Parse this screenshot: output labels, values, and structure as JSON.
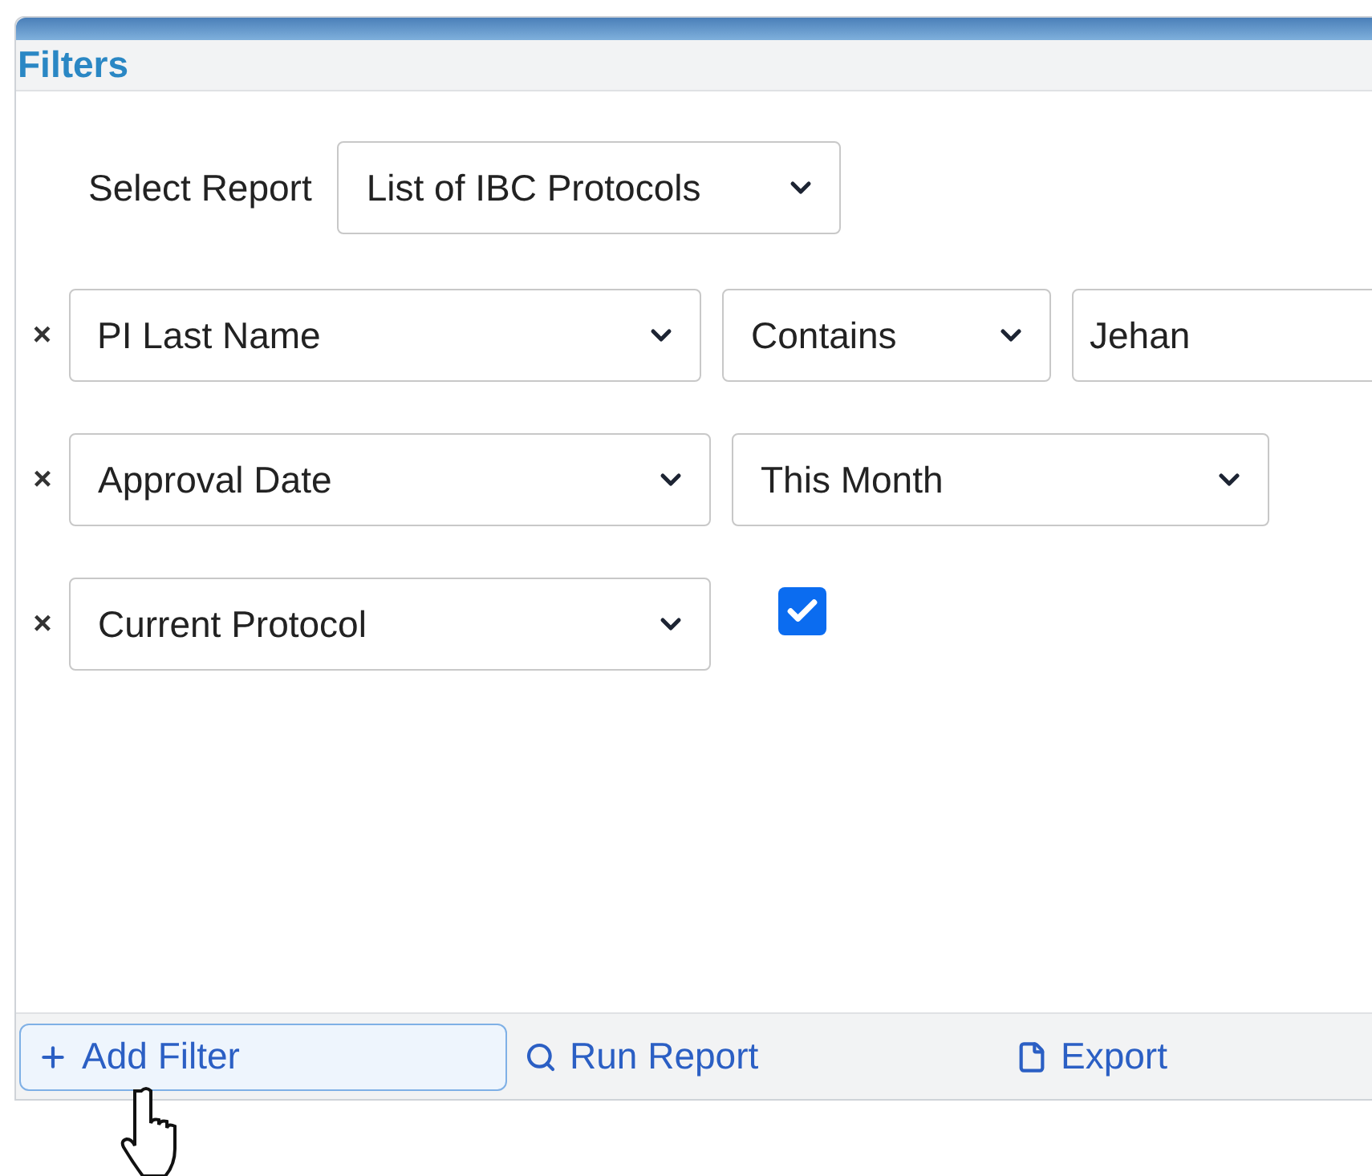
{
  "panel": {
    "title": "Filters"
  },
  "report": {
    "label": "Select Report",
    "value": "List of IBC Protocols"
  },
  "filters": [
    {
      "remove": "×",
      "field": "PI Last Name",
      "operator": {
        "kind": "select",
        "value": "Contains"
      },
      "value": {
        "kind": "input",
        "value": "Jehan"
      }
    },
    {
      "remove": "×",
      "field": "Approval Date",
      "operator": {
        "kind": "select",
        "value": "This Month"
      }
    },
    {
      "remove": "×",
      "field": "Current Protocol",
      "value": {
        "kind": "checkbox",
        "checked": true
      }
    }
  ],
  "footer": {
    "buttons": [
      {
        "kind": "add",
        "label": "Add Filter",
        "focused": true
      },
      {
        "kind": "run",
        "label": "Run Report",
        "focused": false
      },
      {
        "kind": "export",
        "label": "Export",
        "focused": false
      }
    ]
  }
}
